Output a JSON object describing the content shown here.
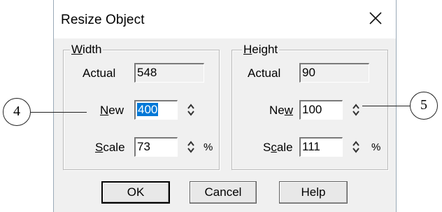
{
  "dialog": {
    "title": "Resize Object",
    "close_icon": "close-icon"
  },
  "width_group": {
    "legend_u": "W",
    "legend_rest": "idth",
    "actual_label": "Actual",
    "actual_value": "548",
    "new_label_u": "N",
    "new_label_rest": "ew",
    "new_value": "400",
    "scale_label_u": "S",
    "scale_label_rest": "cale",
    "scale_value": "73",
    "percent": "%"
  },
  "height_group": {
    "legend_u": "H",
    "legend_rest": "eight",
    "actual_label": "Actual",
    "actual_value": "90",
    "new_label_pre": "Ne",
    "new_label_u": "w",
    "new_value": "100",
    "scale_label_pre": "S",
    "scale_label_u": "c",
    "scale_label_rest": "ale",
    "scale_value": "111",
    "percent": "%"
  },
  "buttons": {
    "ok": "OK",
    "cancel": "Cancel",
    "help": "Help"
  },
  "callouts": {
    "left": "4",
    "right": "5"
  },
  "colors": {
    "selection": "#0078d7",
    "dialog_bg": "#f0f0f0"
  }
}
